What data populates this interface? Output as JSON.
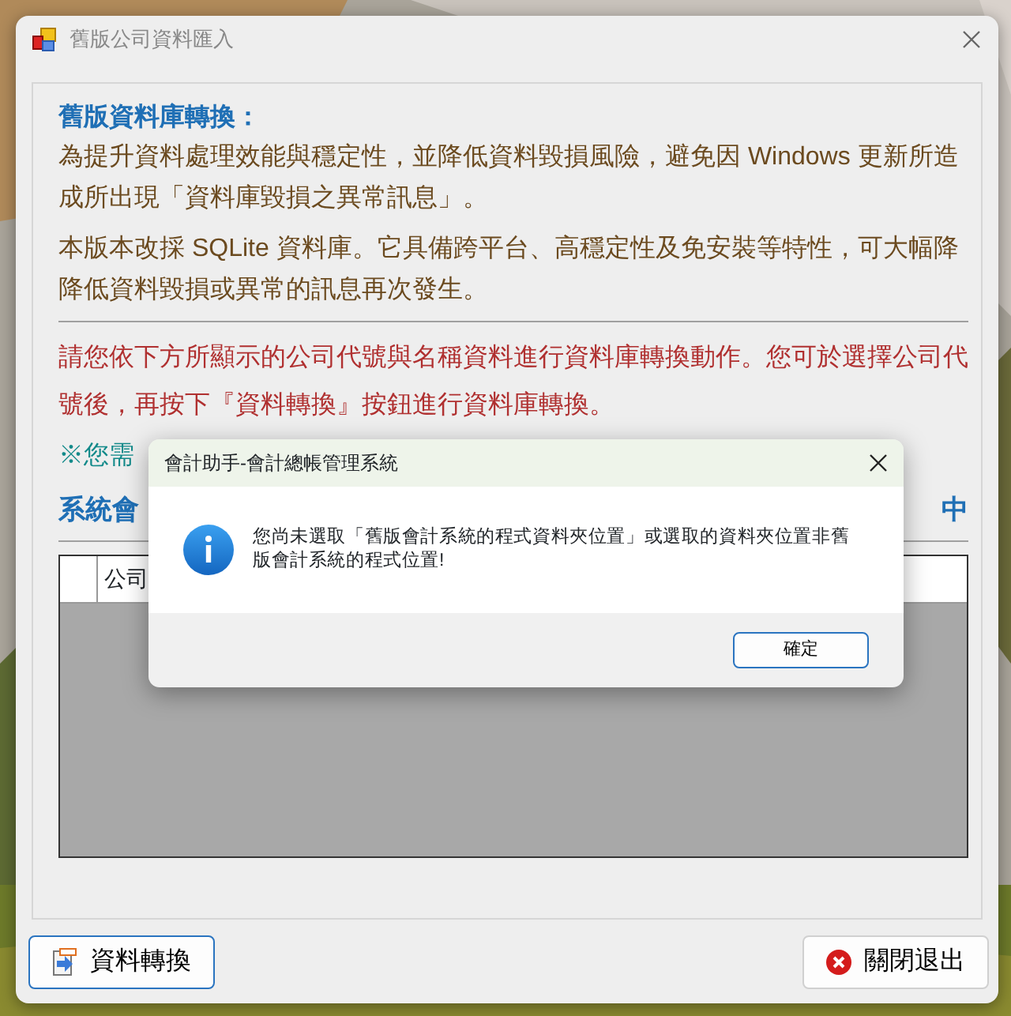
{
  "window": {
    "title": "舊版公司資料匯入"
  },
  "heading": "舊版資料庫轉換：",
  "paragraphs": [
    "為提升資料處理效能與穩定性，並降低資料毀損風險，避免因 Windows 更新所造成所出現「資料庫毀損之異常訊息」。",
    "本版本改採 SQLite 資料庫。它具備跨平台、高穩定性及免安裝等特性，可大幅降降低資料毀損或異常的訊息再次發生。"
  ],
  "instruction": "請您依下方所顯示的公司代號與名稱資料進行資料庫轉換動作。您可於選擇公司代號後，再按下『資料轉換』按鈕進行資料庫轉換。",
  "note": "※您需",
  "section_title": {
    "left": "系統會",
    "right": "中"
  },
  "table": {
    "columns": [
      "公司"
    ]
  },
  "buttons": [
    {
      "kind": "convert",
      "label": "資料轉換",
      "selected": true
    },
    {
      "kind": "close",
      "label": "關閉退出",
      "selected": false
    }
  ],
  "dialog": {
    "title": "會計助手-會計總帳管理系統",
    "message": "您尚未選取「舊版會計系統的程式資料夾位置」或選取的資料夾位置非舊版會計系統的程式位置!",
    "buttons": [
      "確定"
    ]
  }
}
